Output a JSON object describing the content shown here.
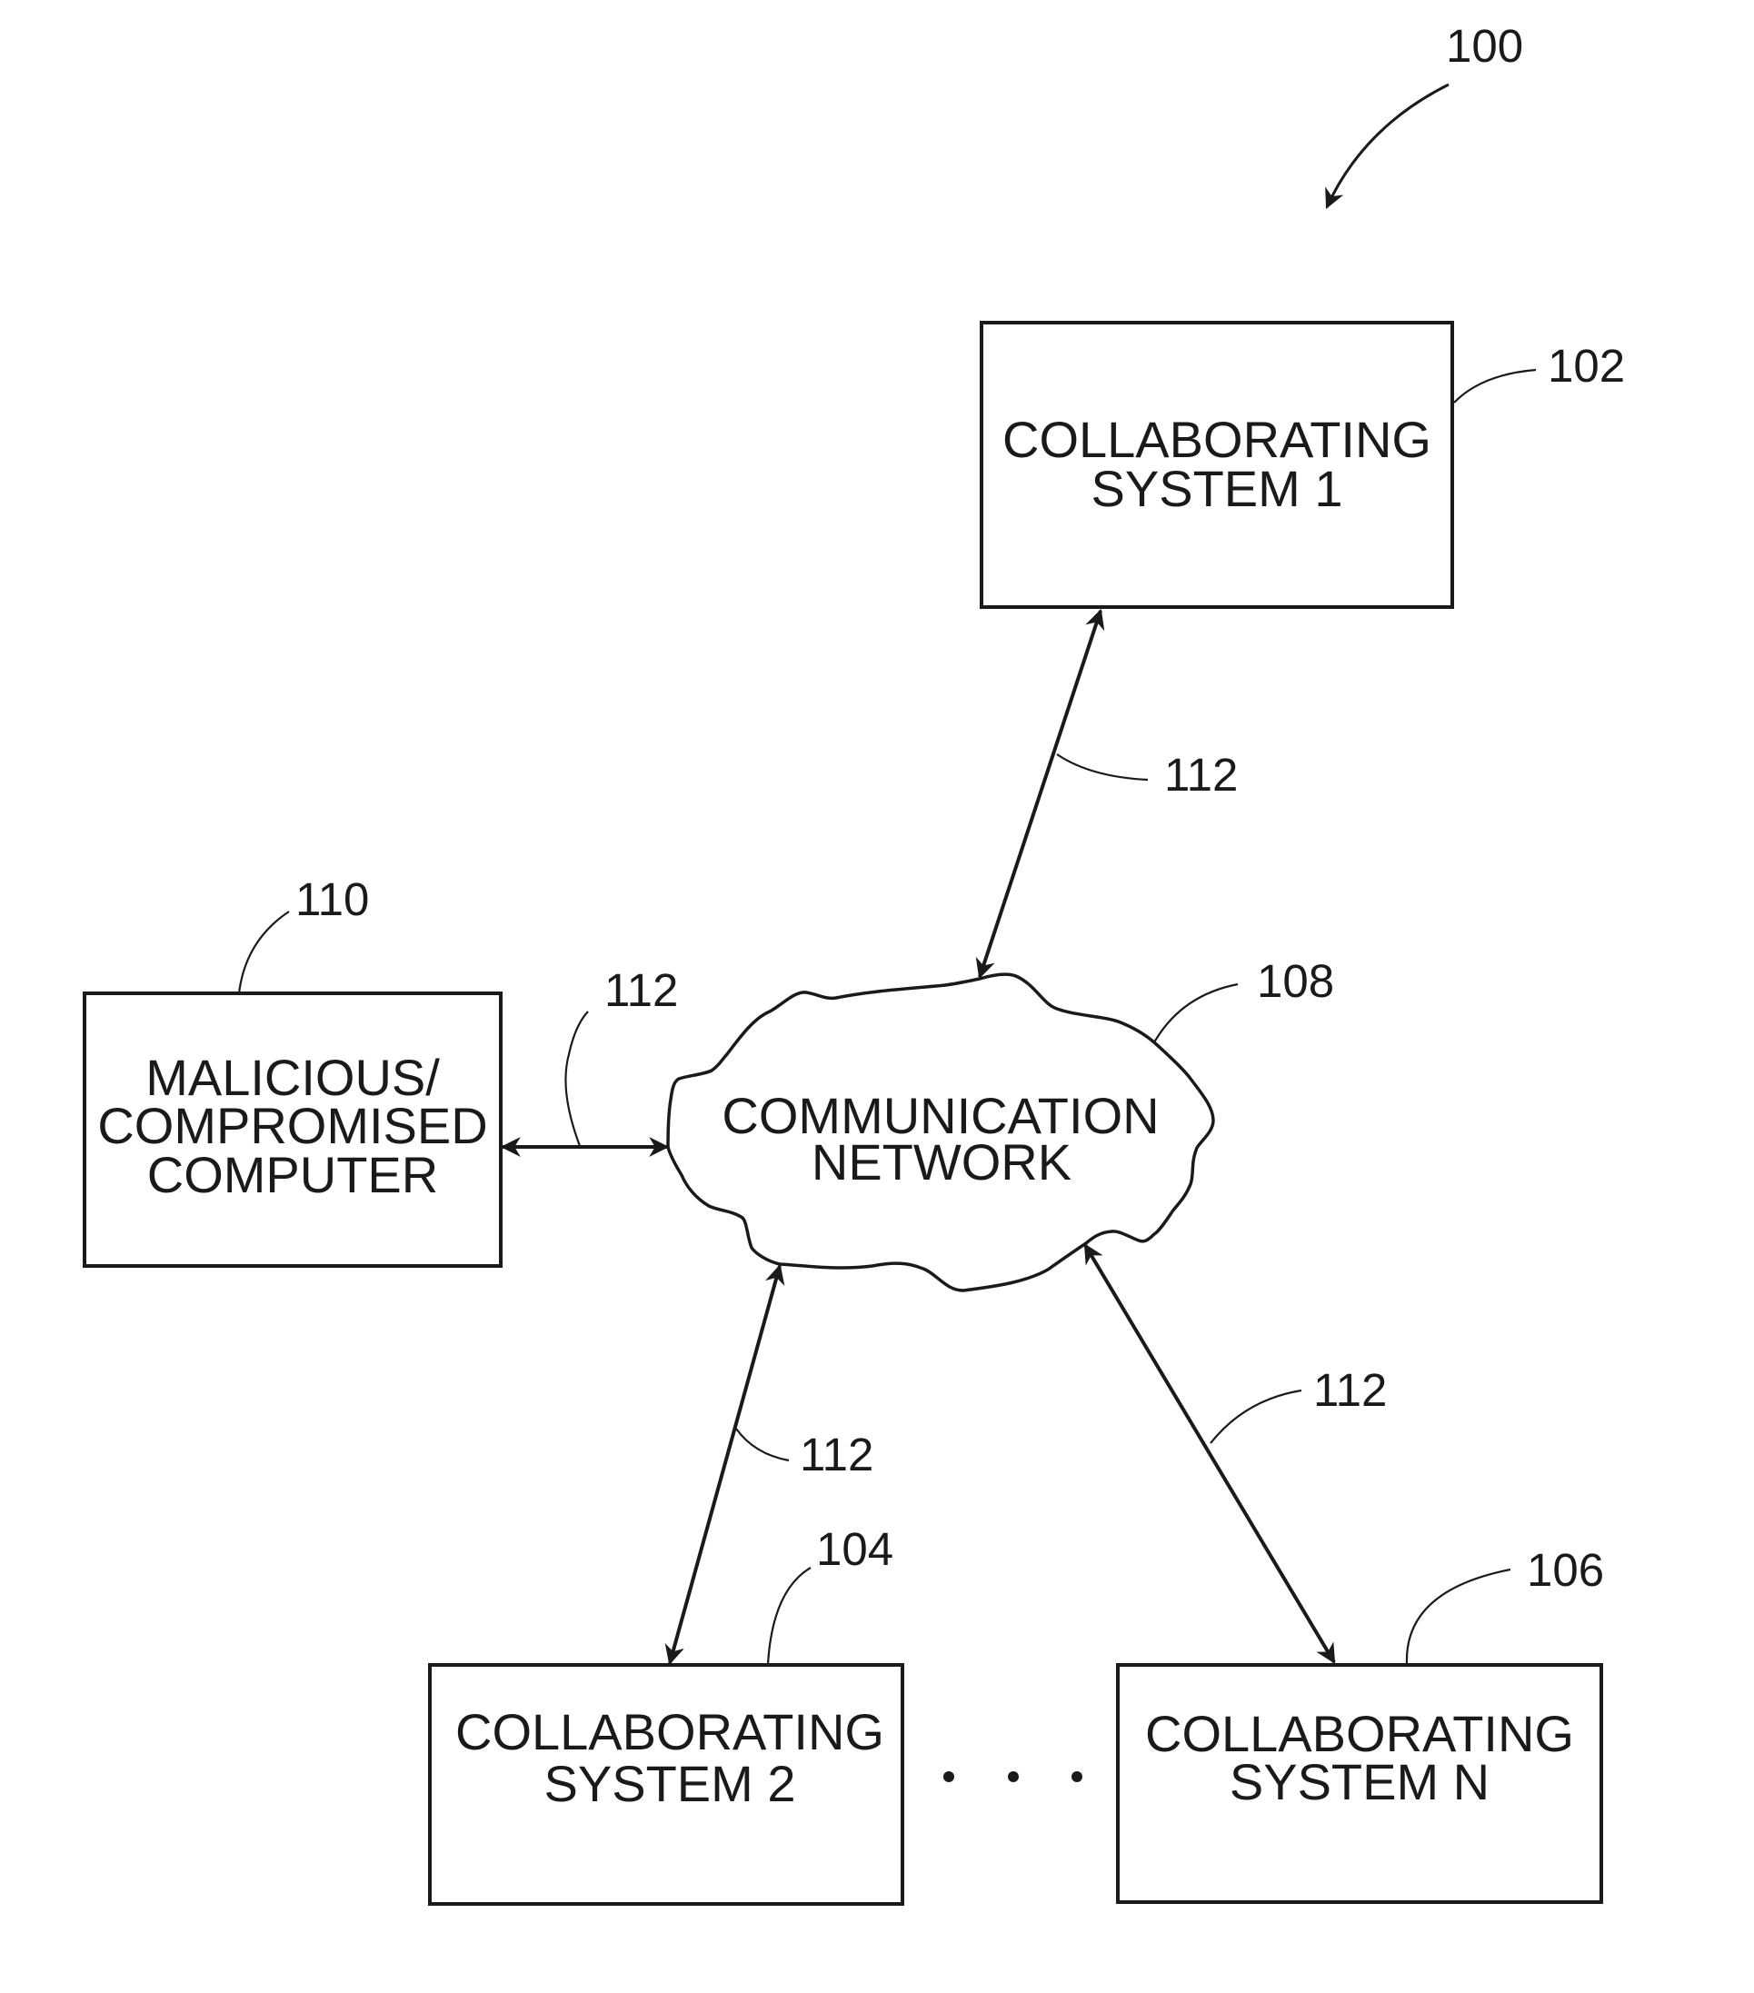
{
  "figure": {
    "reference": "100"
  },
  "nodes": {
    "collab1": {
      "lines": [
        "COLLABORATING",
        "SYSTEM 1"
      ],
      "ref": "102"
    },
    "collab2": {
      "lines": [
        "COLLABORATING",
        "SYSTEM 2"
      ],
      "ref": "104"
    },
    "collabN": {
      "lines": [
        "COLLABORATING",
        "SYSTEM N"
      ],
      "ref": "106"
    },
    "network": {
      "lines": [
        "COMMUNICATION",
        "NETWORK"
      ],
      "ref": "108"
    },
    "malicious": {
      "lines": [
        "MALICIOUS/",
        "COMPROMISED",
        "COMPUTER"
      ],
      "ref": "110"
    }
  },
  "links": {
    "ref": "112",
    "items": [
      {
        "from": "network",
        "to": "collab1",
        "label": "112"
      },
      {
        "from": "malicious",
        "to": "network",
        "label": "112"
      },
      {
        "from": "network",
        "to": "collab2",
        "label": "112"
      },
      {
        "from": "network",
        "to": "collabN",
        "label": "112"
      }
    ]
  },
  "ellipsis": "• • •"
}
